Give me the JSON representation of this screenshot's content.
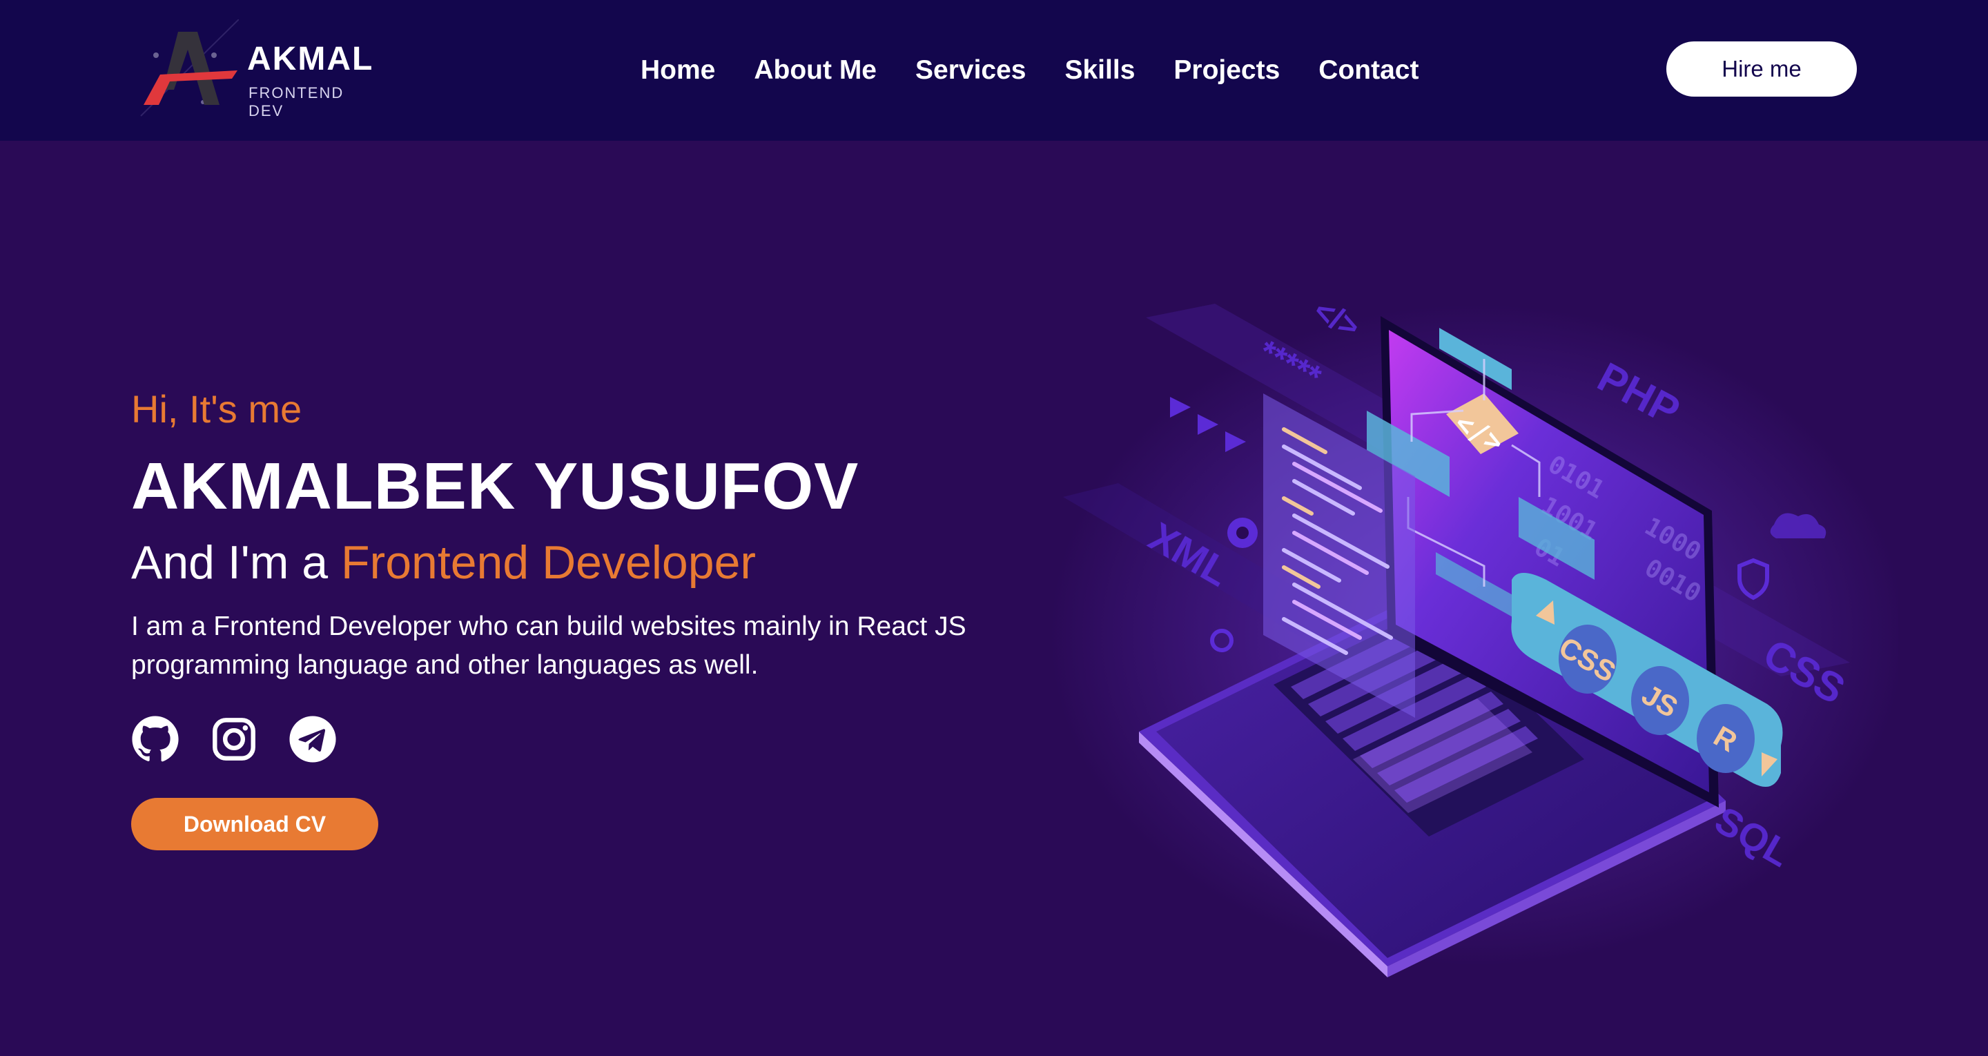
{
  "brand": {
    "name": "AKMAL",
    "tagline": "FRONTEND DEV"
  },
  "nav": {
    "items": [
      {
        "label": "Home"
      },
      {
        "label": "About Me"
      },
      {
        "label": "Services"
      },
      {
        "label": "Skills"
      },
      {
        "label": "Projects"
      },
      {
        "label": "Contact"
      }
    ],
    "hire_label": "Hire me"
  },
  "hero": {
    "greeting": "Hi, It's me",
    "name": "AKMALBEK YUSUFOV",
    "role_prefix": "And I'm a ",
    "role_highlight": "Frontend Developer",
    "description": "I am a Frontend Developer who can build websites mainly in React JS programming language and other languages as well.",
    "socials": [
      {
        "icon": "github-icon"
      },
      {
        "icon": "instagram-icon"
      },
      {
        "icon": "telegram-icon"
      }
    ],
    "cv_label": "Download CV"
  },
  "illustration": {
    "floating_labels": [
      "PHP",
      "XML",
      "CSS",
      "SQL",
      "*****",
      "</>"
    ],
    "pill_badges": [
      "CSS",
      "JS",
      "R"
    ],
    "diamond_label": "</>"
  },
  "colors": {
    "header_bg": "#13064d",
    "page_bg": "#2a0a56",
    "accent": "#e87a33",
    "logo_red": "#e0383c",
    "illustration_cyan": "#5ab4da"
  }
}
